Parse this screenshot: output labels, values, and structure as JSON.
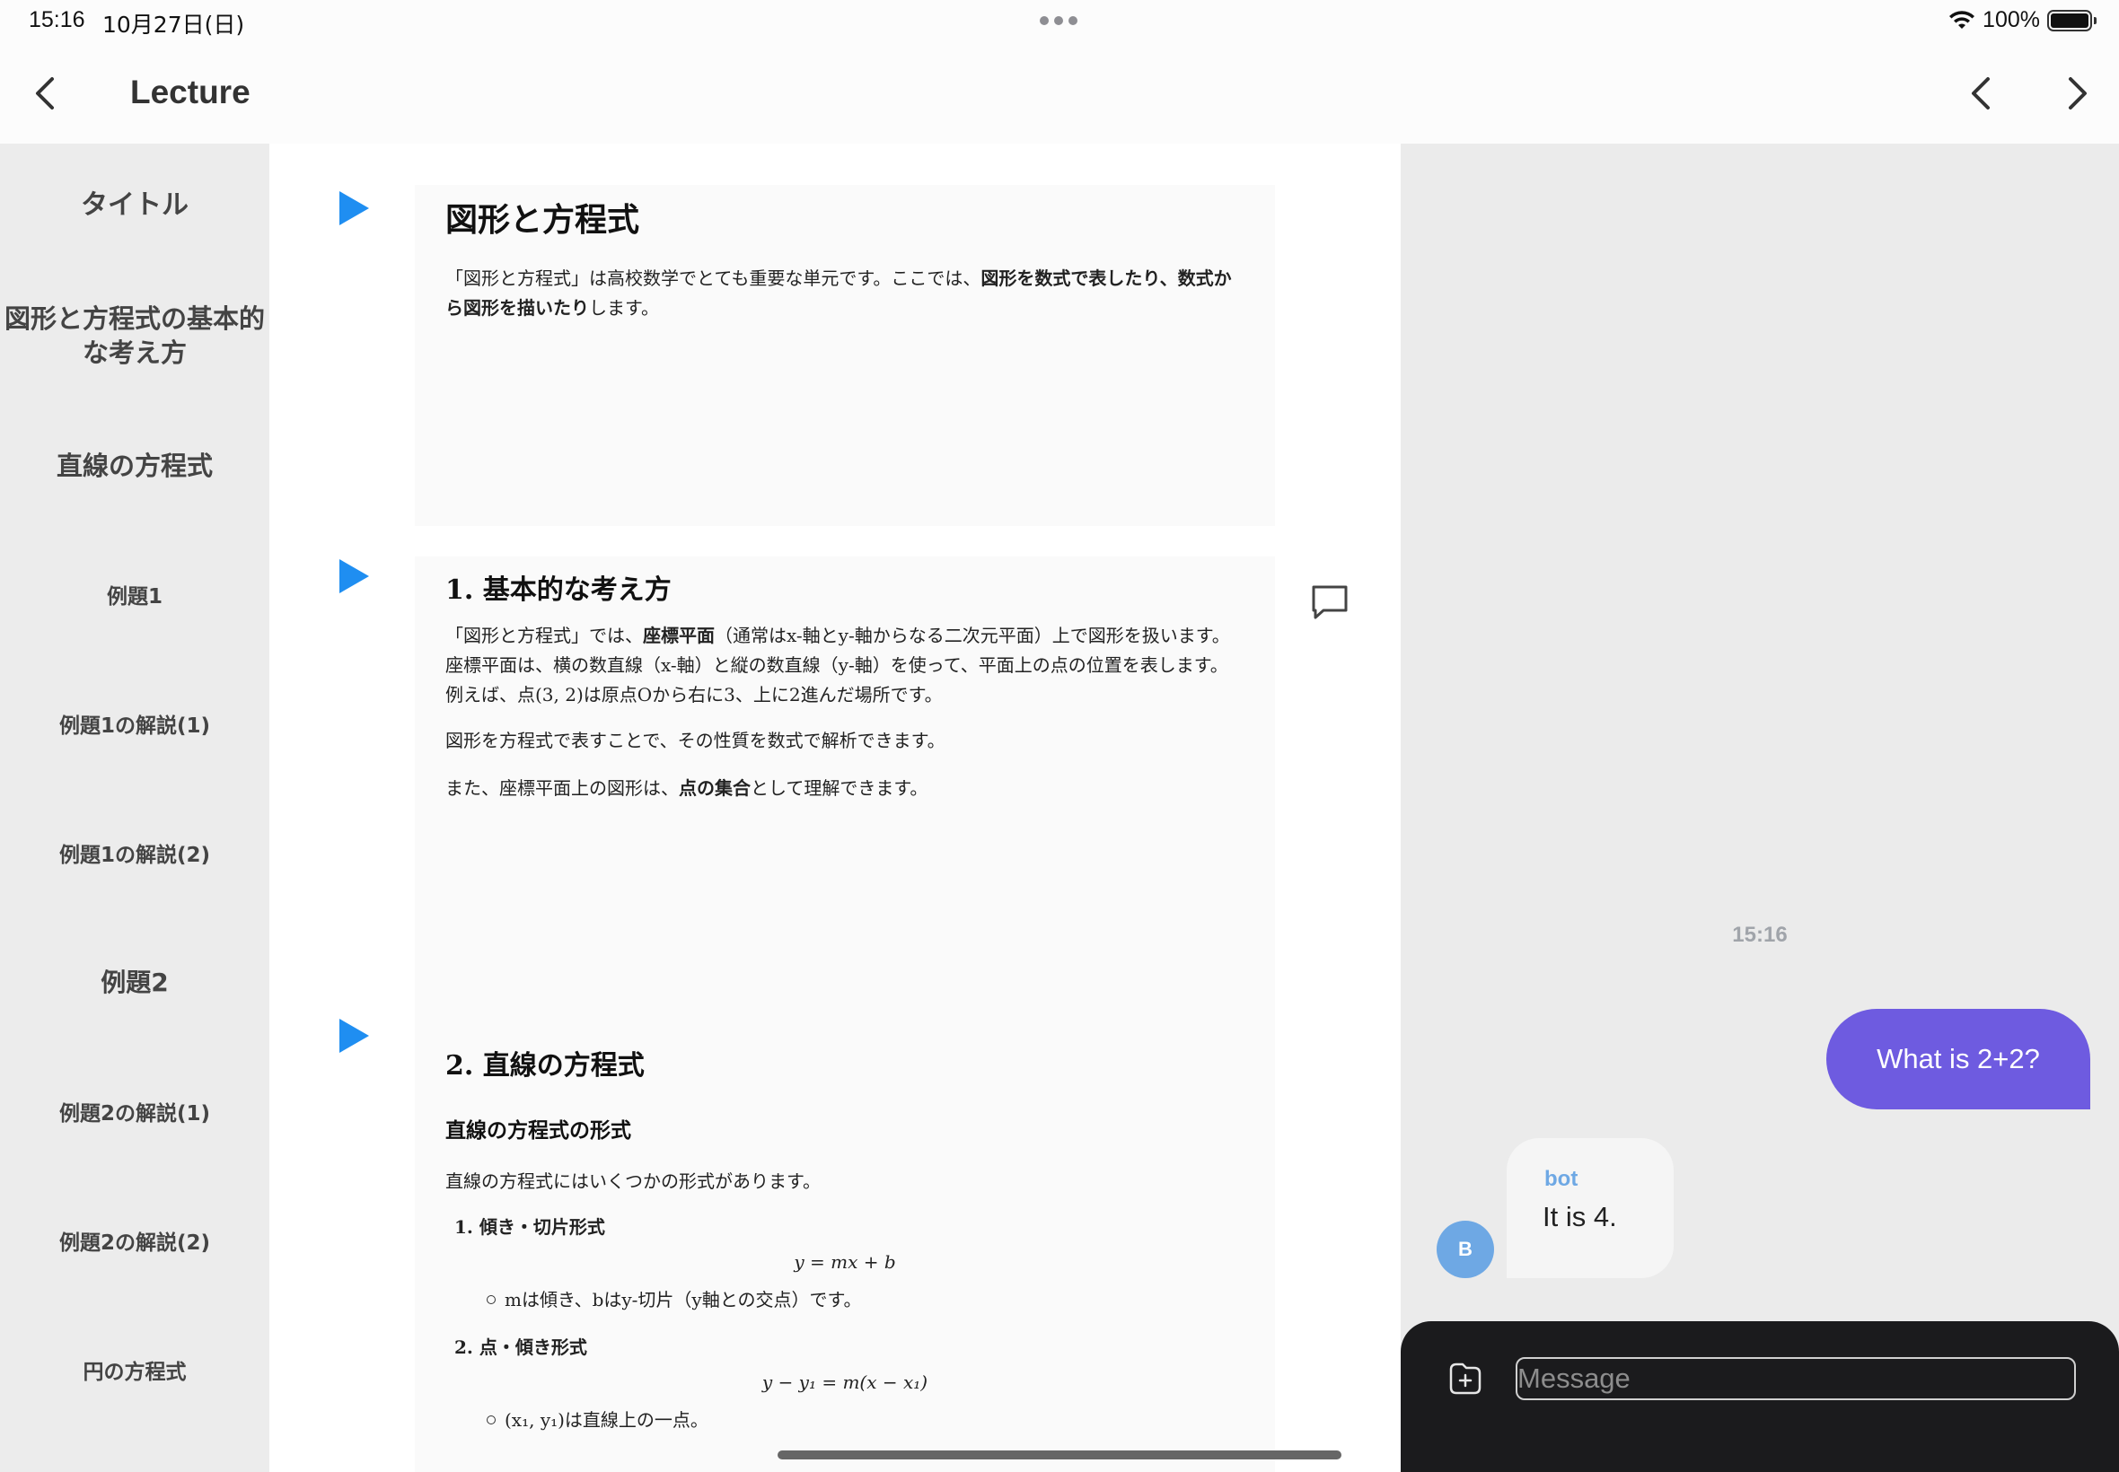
{
  "status_bar": {
    "time": "15:16",
    "date": "10月27日(日)",
    "battery": "100%"
  },
  "nav": {
    "title": "Lecture"
  },
  "sidebar": {
    "items": [
      {
        "label": "タイトル"
      },
      {
        "label": "図形と方程式の基本的な考え方"
      },
      {
        "label": "直線の方程式"
      },
      {
        "label": "例題1"
      },
      {
        "label": "例題1の解説(1)"
      },
      {
        "label": "例題1の解説(2)"
      },
      {
        "label": "例題2"
      },
      {
        "label": "例題2の解説(1)"
      },
      {
        "label": "例題2の解説(2)"
      },
      {
        "label": "円の方程式"
      }
    ]
  },
  "slides": {
    "title_slide": {
      "heading": "図形と方程式",
      "p1_a": "「図形と方程式」は高校数学でとても重要な単元です。ここでは、",
      "p1_b": "図形を数式で表したり、数式から図形を描いたり",
      "p1_c": "します。"
    },
    "basic_slide": {
      "heading": "1. 基本的な考え方",
      "p1_a": "「図形と方程式」では、",
      "p1_b": "座標平面",
      "p1_c": "（通常はx-軸とy-軸からなる二次元平面）上で図形を扱います。座標平面は、横の数直線（x-軸）と縦の数直線（y-軸）を使って、平面上の点の位置を表します。例えば、点(3, 2)は原点Oから右に3、上に2進んだ場所です。",
      "p2": "図形を方程式で表すことで、その性質を数式で解析できます。",
      "p3_a": "また、座標平面上の図形は、",
      "p3_b": "点の集合",
      "p3_c": "として理解できます。"
    },
    "line_slide": {
      "heading": "2. 直線の方程式",
      "subheading": "直線の方程式の形式",
      "intro": "直線の方程式にはいくつかの形式があります。",
      "item1": "1.  傾き・切片形式",
      "formula1": "y = mx + b",
      "bullet1": "mは傾き、bはy-切片（y軸との交点）です。",
      "item2": "2.  点・傾き形式",
      "formula2": "y − y₁ = m(x − x₁)",
      "bullet2": "(x₁, y₁)は直線上の一点。"
    }
  },
  "chat": {
    "timestamp": "15:16",
    "user_message": "What is 2+2?",
    "bot_name": "bot",
    "bot_avatar_letter": "B",
    "bot_message": "It is 4.",
    "input_placeholder": "Message"
  },
  "colors": {
    "accent_play": "#1f8ef1",
    "user_bubble": "#6e5be0",
    "bot_name": "#6ea8e4",
    "composer_bg": "#1b1b1d"
  }
}
